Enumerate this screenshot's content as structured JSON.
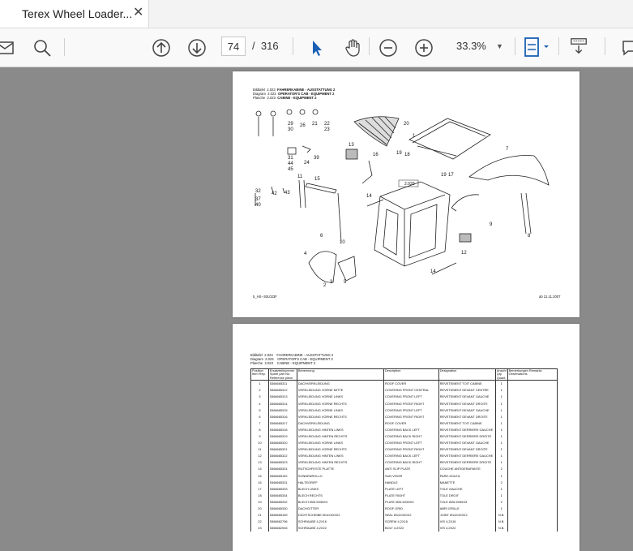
{
  "tab": {
    "title": "Terex Wheel Loader...",
    "close": "✕"
  },
  "toolbar": {
    "page_current": "74",
    "page_sep": "/",
    "page_total": "316",
    "zoom": "33.3%",
    "icons": [
      "mail-icon",
      "search-icon",
      "page-up-icon",
      "page-down-icon",
      "select-cursor-icon",
      "hand-tool-icon",
      "zoom-out-icon",
      "zoom-in-icon",
      "fit-page-icon",
      "read-aloud-icon",
      "comment-icon"
    ]
  },
  "page1": {
    "header": {
      "rows": [
        {
          "k": "Bildtafel",
          "v": "2.023",
          "t": "FAHRERKABINE - AUSSTATTUNG 2"
        },
        {
          "k": "Diagram",
          "v": "2.023",
          "t": "OPERATOR'S CAB - EQUIPMENT 2"
        },
        {
          "k": "Planche",
          "v": "2.023",
          "t": "CABINE - EQUIPMENT 2"
        }
      ]
    },
    "labels": [
      "20",
      "1",
      "29",
      "30",
      "26",
      "21",
      "22",
      "23",
      "13",
      "16",
      "19",
      "18",
      "7",
      "31",
      "44",
      "45",
      "24",
      "39",
      "2.020",
      "19",
      "17",
      "11",
      "15",
      "14",
      "32",
      "37",
      "42",
      "43",
      "8",
      "9",
      "6",
      "10",
      "4",
      "5",
      "3",
      "2",
      "12",
      "14",
      "40"
    ],
    "footer_left": "5_HS--30L023F",
    "footer_right": "ab 21.11.2007"
  },
  "page2": {
    "header": {
      "rows": [
        {
          "k": "Bildtafel",
          "v": "2.023",
          "t": "FAHRERKABINE - AUSSTATTUNG 2"
        },
        {
          "k": "Diagram",
          "v": "2.023",
          "t": "OPERATOR'S CAB - EQUIPMENT 2"
        },
        {
          "k": "Planche",
          "v": "2.023",
          "t": "CABINE - EQUIPMENT 2"
        }
      ]
    },
    "columns": [
      "Position Item Rep.",
      "Ersatzteilnummer Spare part No. Référence pièce",
      "Benennung",
      "Description",
      "Désignation",
      "Anzahl Qty. Quant.",
      "Bemerkungen Remarks Observations"
    ],
    "rows": [
      [
        "1",
        "5366665311",
        "DACHVERKLEIDUNG",
        "ROOF COVER",
        "REVETEMENT TOIT CABINE",
        "1",
        ""
      ],
      [
        "2",
        "5366665312",
        "VERKLEIDUNG VORNE MITTE",
        "COVERING FRONT CENTRAL",
        "REVETEMENT DEVANT CENTRE",
        "1",
        ""
      ],
      [
        "3",
        "5366665313",
        "VERKLEIDUNG VORNE LINKS",
        "COVERING FRONT LEFT",
        "REVETEMENT DEVANT GAUCHE",
        "1",
        ""
      ],
      [
        "4",
        "5366665314",
        "VERKLEIDUNG VORNE RECHTS",
        "COVERING FRONT RIGHT",
        "REVETEMENT DEVANT DROITE",
        "1",
        ""
      ],
      [
        "5",
        "5366665315",
        "VERKLEIDUNG VORNE LINKS",
        "COVERING FRONT LEFT",
        "REVETEMENT DEVANT GAUCHE",
        "1",
        ""
      ],
      [
        "6",
        "5366665316",
        "VERKLEIDUNG VORNE RECHTS",
        "COVERING FRONT RIGHT",
        "REVETEMENT DEVANT DROITE",
        "1",
        ""
      ],
      [
        "7",
        "5366665317",
        "DACHVERKLEIDUNG",
        "ROOF COVER",
        "REVETEMENT TOIT CABINE",
        "1",
        ""
      ],
      [
        "8",
        "5366665318",
        "VERKLEIDUNG HINTEN LINKS",
        "COVERING BACK LEFT",
        "REVETEMENT DERRIERE GAUCHE",
        "1",
        ""
      ],
      [
        "9",
        "5366665319",
        "VERKLEIDUNG HINTEN RECHTS",
        "COVERING BACK RIGHT",
        "REVETEMENT DERRIERE DROITE",
        "1",
        ""
      ],
      [
        "10",
        "5366665320",
        "VERKLEIDUNG VORNE LINKS",
        "COVERING FRONT LEFT",
        "REVETEMENT DEVANT GAUCHE",
        "1",
        ""
      ],
      [
        "11",
        "5366665321",
        "VERKLEIDUNG VORNE RECHTS",
        "COVERING FRONT RIGHT",
        "REVETEMENT DEVANT DROITE",
        "1",
        ""
      ],
      [
        "12",
        "5366665322",
        "VERKLEIDUNG HINTEN LINKS",
        "COVERING BACK LEFT",
        "REVETEMENT DERRIERE GAUCHE",
        "1",
        ""
      ],
      [
        "13",
        "5366665323",
        "VERKLEIDUNG HINTEN RECHTS",
        "COVERING BACK RIGHT",
        "REVETEMENT DERRIERE DROITE",
        "1",
        ""
      ],
      [
        "14",
        "5366665324",
        "RUTSCHFESTE PLATTE",
        "ANTI SLIP PLATE",
        "COUCHE ANTIDERAPANTE",
        "2",
        ""
      ],
      [
        "15",
        "5366665152",
        "SONNENROLLO",
        "SUN VISOR",
        "PARE-SOLEIL",
        "1",
        ""
      ],
      [
        "16",
        "5366665331",
        "HALTEGRIFF",
        "HANDLE",
        "MANETTE",
        "2",
        ""
      ],
      [
        "17",
        "5366665333",
        "BLECH LINKS",
        "PLATE LEFT",
        "TOLE GAUCHE",
        "1",
        ""
      ],
      [
        "18",
        "5366665334",
        "BLECH RECHTS",
        "PLATE RIGHT",
        "TOLE DROIT",
        "1",
        ""
      ],
      [
        "19",
        "5366665332",
        "BLECH Ø26.5X55X3",
        "PLATE Ø26.5X55X3",
        "TOLE Ø26.5X55X3",
        "2",
        ""
      ],
      [
        "20",
        "5366665330",
        "DACHGITTER",
        "ROOF GRID",
        "ABRI GRILLE",
        "1",
        ""
      ],
      [
        "21",
        "5366665169",
        "DICHTSCHEIBE Ø14X4X0X2",
        "SEAL Ø14X4X0X2",
        "JOINT Ø14X4X0X2",
        "N.B.",
        ""
      ],
      [
        "22",
        "5366662796",
        "SCHRAUBE 4,2X16",
        "SCREW 4,2X16",
        "VIS 4,2X16",
        "N.B.",
        ""
      ],
      [
        "23",
        "5366662945",
        "SCHRAUBE 4,2X22",
        "BOLT 4,2X22",
        "VIS 4,2X22",
        "N.B.",
        ""
      ]
    ]
  }
}
